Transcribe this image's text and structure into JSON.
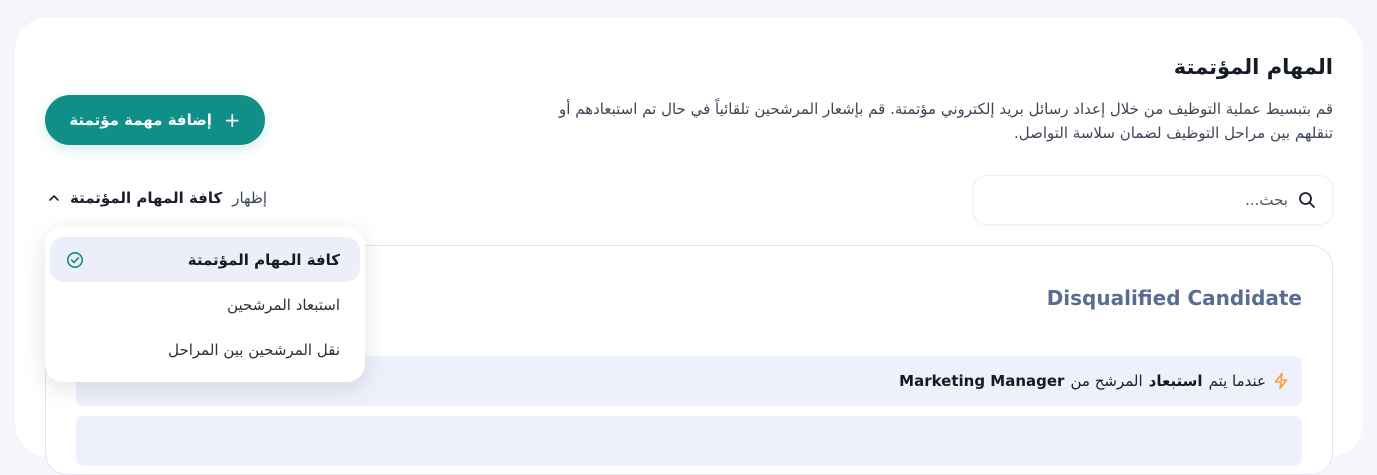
{
  "header": {
    "title": "المهام المؤتمتة",
    "description": "قم بتبسيط عملية التوظيف من خلال إعداد رسائل بريد إلكتروني مؤتمتة. قم بإشعار المرشحين تلقائياً في حال تم استبعادهم أو تنقلهم بين مراحل التوظيف لضمان سلاسة التواصل."
  },
  "add_button": {
    "label": "إضافة مهمة مؤتمتة",
    "icon": "plus-icon"
  },
  "filter": {
    "prefix": "إظهار",
    "selected": "كافة المهام المؤتمتة",
    "icon": "chevron-up-icon",
    "options": [
      {
        "label": "كافة المهام المؤتمتة",
        "selected": true
      },
      {
        "label": "استبعاد المرشحين",
        "selected": false
      },
      {
        "label": "نقل المرشحين بين المراحل",
        "selected": false
      }
    ]
  },
  "search": {
    "placeholder": "بحث...",
    "value": "",
    "icon": "search-icon"
  },
  "task": {
    "title": "Disqualified Candidate",
    "trigger": {
      "icon": "lightning-icon",
      "pre": "عندما يتم",
      "action": "استبعاد",
      "mid": "المرشح من",
      "job": "Marketing Manager"
    }
  },
  "colors": {
    "primary": "#0f8f88",
    "task_title": "#5a6c90",
    "row_bg": "#eef0fb",
    "lightning": "#f2a33a"
  }
}
